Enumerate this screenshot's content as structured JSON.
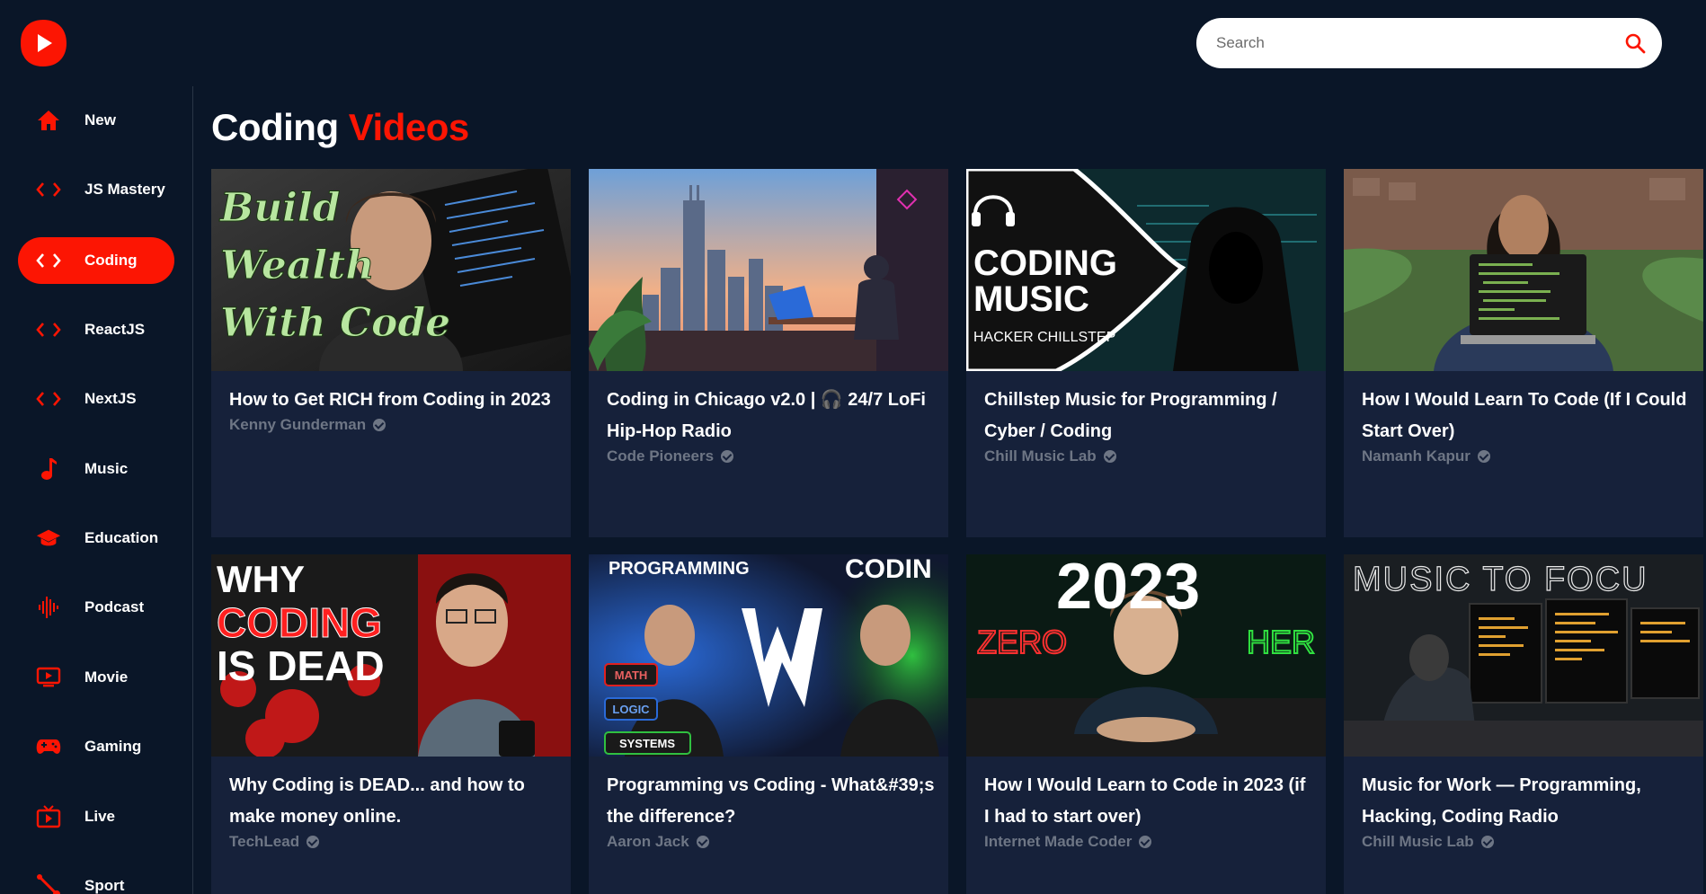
{
  "search": {
    "placeholder": "Search"
  },
  "sidebar": {
    "items": [
      {
        "label": "New",
        "icon": "home-icon",
        "active": false
      },
      {
        "label": "JS Mastery",
        "icon": "code-icon",
        "active": false
      },
      {
        "label": "Coding",
        "icon": "code-icon",
        "active": true
      },
      {
        "label": "ReactJS",
        "icon": "code-icon",
        "active": false
      },
      {
        "label": "NextJS",
        "icon": "code-icon",
        "active": false
      },
      {
        "label": "Music",
        "icon": "music-note-icon",
        "active": false
      },
      {
        "label": "Education",
        "icon": "graduation-cap-icon",
        "active": false
      },
      {
        "label": "Podcast",
        "icon": "soundwave-icon",
        "active": false
      },
      {
        "label": "Movie",
        "icon": "screen-play-icon",
        "active": false
      },
      {
        "label": "Gaming",
        "icon": "gamepad-icon",
        "active": false
      },
      {
        "label": "Live",
        "icon": "live-tv-icon",
        "active": false
      },
      {
        "label": "Sport",
        "icon": "sport-icon",
        "active": false
      }
    ]
  },
  "main": {
    "title_prefix": "Coding",
    "title_accent": "Videos",
    "videos": [
      {
        "title": "How to Get RICH from Coding in 2023",
        "channel": "Kenny Gunderman",
        "thumb_text": [
          "Build",
          "Wealth",
          "With Code"
        ]
      },
      {
        "title": "Coding in Chicago v2.0 | 🎧 24/7 LoFi Hip-Hop Radio",
        "channel": "Code Pioneers",
        "thumb_text": []
      },
      {
        "title": "Chillstep Music for Programming / Cyber / Coding",
        "channel": "Chill Music Lab",
        "thumb_text": [
          "CODING",
          "MUSIC",
          "HACKER CHILLSTEP"
        ]
      },
      {
        "title": "How I Would Learn To Code (If I Could Start Over)",
        "channel": "Namanh Kapur",
        "thumb_text": []
      },
      {
        "title": "Why Coding is DEAD... and how to make money online.",
        "channel": "TechLead",
        "thumb_text": [
          "WHY",
          "CODING",
          "IS DEAD"
        ]
      },
      {
        "title": "Programming vs Coding - What&#39;s the difference?",
        "channel": "Aaron Jack",
        "thumb_text": [
          "PROGRAMMING",
          "CODIN",
          "VS",
          "MATH",
          "LOGIC",
          "SYSTEMS"
        ]
      },
      {
        "title": "How I Would Learn to Code in 2023 (if I had to start over)",
        "channel": "Internet Made Coder",
        "thumb_text": [
          "2023",
          "ZERO",
          "HER"
        ]
      },
      {
        "title": "Music for Work — Programming, Hacking, Coding Radio",
        "channel": "Chill Music Lab",
        "thumb_text": [
          "MUSIC TO FOCU"
        ]
      }
    ]
  },
  "colors": {
    "accent": "#fc1503",
    "background": "#0a1628",
    "card": "#16213a",
    "muted": "#6e7685"
  }
}
